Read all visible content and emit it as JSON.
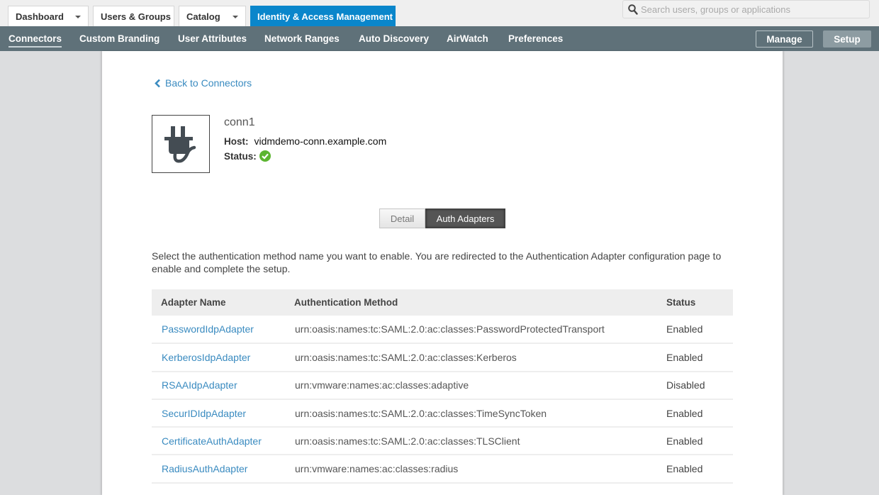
{
  "topbar": {
    "tabs": [
      {
        "label": "Dashboard",
        "dropdown": true,
        "active": false
      },
      {
        "label": "Users & Groups",
        "dropdown": false,
        "active": false
      },
      {
        "label": "Catalog",
        "dropdown": true,
        "active": false
      },
      {
        "label": "Identity & Access Management",
        "dropdown": false,
        "active": true
      }
    ],
    "search": {
      "placeholder": "Search users, groups or applications",
      "value": "",
      "icon": "search-icon"
    }
  },
  "subnav": {
    "items": [
      {
        "label": "Connectors",
        "active": true
      },
      {
        "label": "Custom Branding"
      },
      {
        "label": "User Attributes"
      },
      {
        "label": "Network Ranges"
      },
      {
        "label": "Auto Discovery"
      },
      {
        "label": "AirWatch"
      },
      {
        "label": "Preferences"
      }
    ],
    "manage_label": "Manage",
    "setup_label": "Setup",
    "active_mode": "Setup"
  },
  "connector": {
    "back_label": "Back to Connectors",
    "icon": "plug-icon",
    "name": "conn1",
    "host_label": "Host:",
    "host_value": "vidmdemo-conn.example.com",
    "status_label": "Status:",
    "status_icon": "check-circle-icon",
    "status_color": "#5cb531"
  },
  "segment": {
    "detail_label": "Detail",
    "auth_label": "Auth Adapters",
    "active": "Auth Adapters"
  },
  "description": "Select the authentication method name you want to enable. You are redirected to the Authentication Adapter configuration page to enable and complete the setup.",
  "table": {
    "headers": [
      "Adapter Name",
      "Authentication Method",
      "Status"
    ],
    "rows": [
      {
        "name": "PasswordIdpAdapter",
        "method": "urn:oasis:names:tc:SAML:2.0:ac:classes:PasswordProtectedTransport",
        "status": "Enabled"
      },
      {
        "name": "KerberosIdpAdapter",
        "method": "urn:oasis:names:tc:SAML:2.0:ac:classes:Kerberos",
        "status": "Enabled"
      },
      {
        "name": "RSAAIdpAdapter",
        "method": "urn:vmware:names:ac:classes:adaptive",
        "status": "Disabled"
      },
      {
        "name": "SecurIDIdpAdapter",
        "method": "urn:oasis:names:tc:SAML:2.0:ac:classes:TimeSyncToken",
        "status": "Enabled"
      },
      {
        "name": "CertificateAuthAdapter",
        "method": "urn:oasis:names:tc:SAML:2.0:ac:classes:TLSClient",
        "status": "Enabled"
      },
      {
        "name": "RadiusAuthAdapter",
        "method": "urn:vmware:names:ac:classes:radius",
        "status": "Enabled"
      }
    ]
  },
  "colors": {
    "accent": "#0a86cb",
    "subnav_bg": "#5f7179",
    "link": "#3a8bc0"
  }
}
